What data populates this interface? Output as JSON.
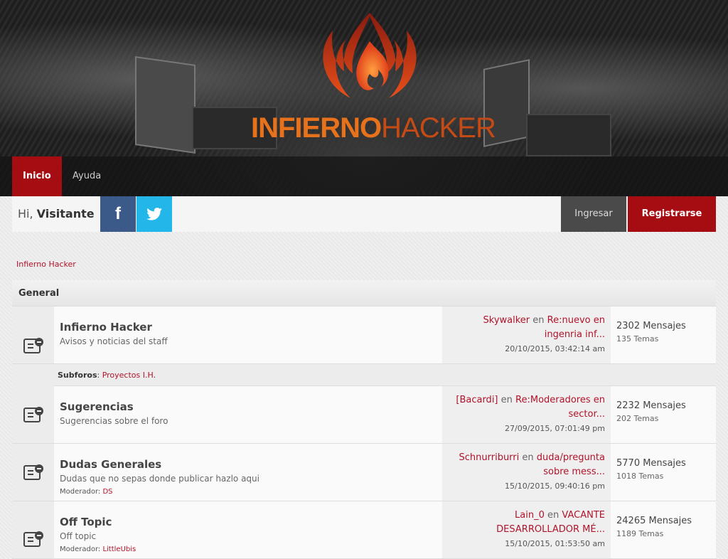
{
  "header": {
    "logo_part1": "INFIERNO",
    "logo_part2": "HACKER",
    "nav": [
      {
        "label": "Inicio",
        "active": true
      },
      {
        "label": "Ayuda",
        "active": false
      }
    ]
  },
  "userbar": {
    "greeting": "Hi,",
    "username": "Visitante",
    "facebook_glyph": "f",
    "login_label": "Ingresar",
    "register_label": "Registrarse"
  },
  "breadcrumb": "Infierno Hacker",
  "category": {
    "title": "General",
    "boards": [
      {
        "name": "Infierno Hacker",
        "description": "Avisos y noticias del staff",
        "moderator_label": "",
        "moderator": "",
        "last_user": "Skywalker",
        "last_en": "en",
        "last_topic_1": "Re:nuevo en",
        "last_topic_2": "ingenria inf...",
        "last_date": "20/10/2015, 03:42:14 am",
        "posts": "2302 Mensajes",
        "topics": "135 Temas",
        "subforums_label": "Subforos",
        "subforums": "Proyectos I.H."
      },
      {
        "name": "Sugerencias",
        "description": "Sugerencias sobre el foro",
        "moderator_label": "",
        "moderator": "",
        "last_user": "[Bacardi]",
        "last_en": "en",
        "last_topic_1": "Re:Moderadores en",
        "last_topic_2": "sector...",
        "last_date": "27/09/2015, 07:01:49 pm",
        "posts": "2232 Mensajes",
        "topics": "202 Temas"
      },
      {
        "name": "Dudas Generales",
        "description": "Dudas que no sepas donde publicar hazlo aqui",
        "moderator_label": "Moderador:",
        "moderator": "DS",
        "last_user": "Schnurriburri",
        "last_en": "en",
        "last_topic_1": "duda/pregunta",
        "last_topic_2": "sobre mess...",
        "last_date": "15/10/2015, 09:40:16 pm",
        "posts": "5770 Mensajes",
        "topics": "1018 Temas"
      },
      {
        "name": "Off Topic",
        "description": "Off topic",
        "moderator_label": "Moderador:",
        "moderator": "LittleUbis",
        "last_user": "Lain_0",
        "last_en": "en",
        "last_topic_1": "VACANTE",
        "last_topic_2": "DESARROLLADOR MÉ...",
        "last_date": "15/10/2015, 01:53:50 am",
        "posts": "24265 Mensajes",
        "topics": "1189 Temas"
      }
    ]
  },
  "colors": {
    "accent": "#a50d12",
    "link": "#b0132a",
    "facebook": "#3b5a8a",
    "twitter": "#22b7e8"
  }
}
